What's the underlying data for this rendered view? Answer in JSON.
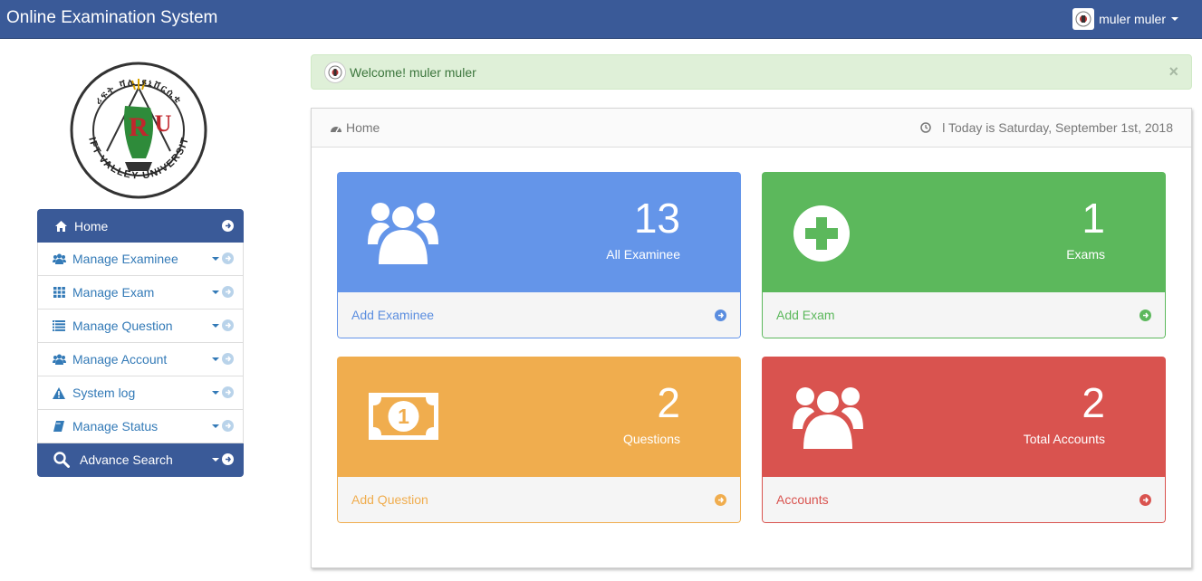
{
  "app": {
    "title": "Online Examination System",
    "user_name": "muler muler",
    "logo_text": "RIFT VALLEY UNIVERSITY"
  },
  "alert": {
    "message": "Welcome! muler muler",
    "close": "×"
  },
  "panel": {
    "breadcrumb": "Home",
    "date_text": "l Today is Saturday, September 1st, 2018"
  },
  "sidebar": {
    "items": [
      {
        "label": "Home",
        "icon": "home-icon"
      },
      {
        "label": "Manage Examinee",
        "icon": "users-icon"
      },
      {
        "label": "Manage Exam",
        "icon": "grid-icon"
      },
      {
        "label": "Manage Question",
        "icon": "list-icon"
      },
      {
        "label": "Manage Account",
        "icon": "users-icon"
      },
      {
        "label": "System log",
        "icon": "warning-icon"
      },
      {
        "label": "Manage Status",
        "icon": "book-icon"
      },
      {
        "label": "Advance Search",
        "icon": "search-icon"
      }
    ]
  },
  "cards": {
    "examinee": {
      "count": "13",
      "label": "All Examinee",
      "link": "Add Examinee",
      "icon": "users-icon"
    },
    "exams": {
      "count": "1",
      "label": "Exams",
      "link": "Add Exam",
      "icon": "plus-circle-icon"
    },
    "questions": {
      "count": "2",
      "label": "Questions",
      "link": "Add Question",
      "icon": "money-icon"
    },
    "accounts": {
      "count": "2",
      "label": "Total Accounts",
      "link": "Accounts",
      "icon": "users-icon"
    }
  },
  "colors": {
    "navbar": "#3a5a98",
    "blue": "#6495e9",
    "green": "#5cb85c",
    "orange": "#f0ad4e",
    "red": "#d9534f",
    "alert_bg": "#dff0d8"
  }
}
